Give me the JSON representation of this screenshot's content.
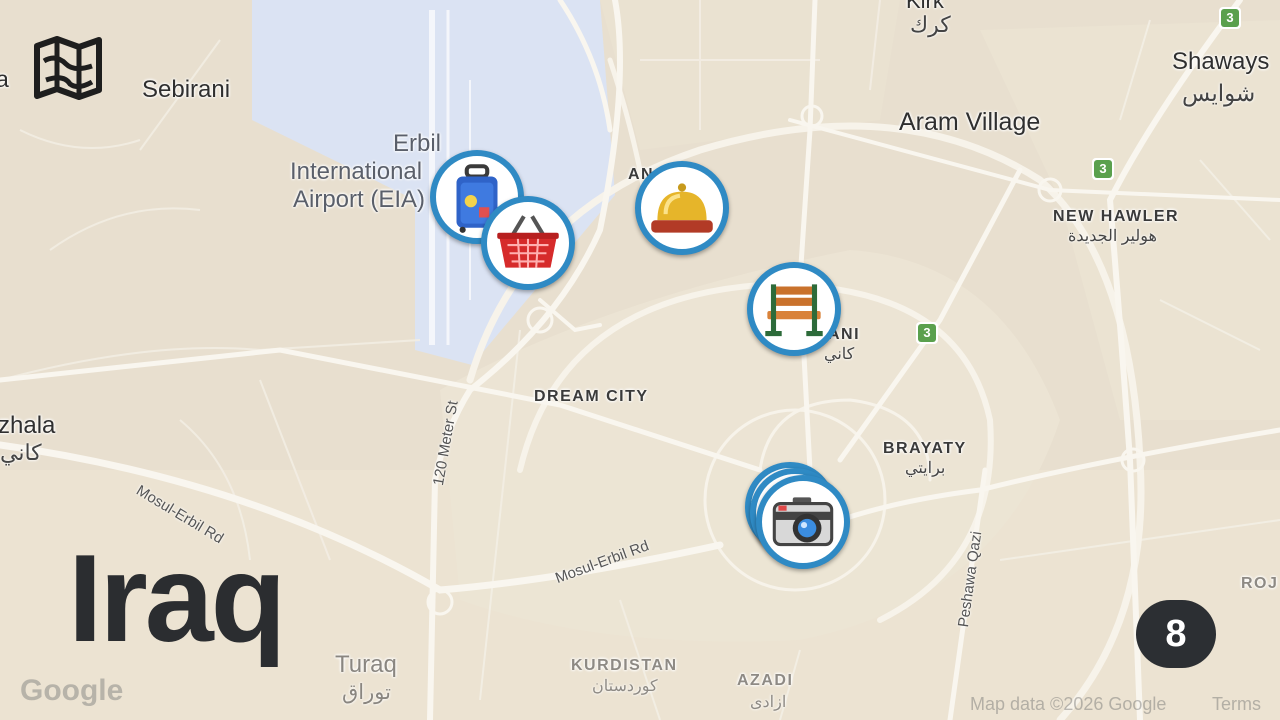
{
  "country_title": "Iraq",
  "marker_count": "8",
  "places": {
    "sebirani": "Sebirani",
    "airport_line1": "Erbil",
    "airport_line2": "International",
    "airport_line3": "Airport (EIA)",
    "aram_village": "Aram Village",
    "shaways": "Shaways",
    "shaways_ar": "شوايس",
    "kirk_ar": "كرك",
    "kirk": "Kirk",
    "new_hawler": "NEW HAWLER",
    "new_hawler_ar": "هولير الجديدة",
    "kani": "ANI",
    "kani_ar": "كاني",
    "dream_city": "DREAM CITY",
    "brayaty": "BRAYATY",
    "brayaty_ar": "برايتي",
    "zhala": "zhala",
    "zhala_ar": "كاني",
    "turaq": "Turaq",
    "turaq_ar": "توراق",
    "kurdistan": "KURDISTAN",
    "kurdistan_ar": "كوردستان",
    "azadi": "AZADI",
    "azadi_ar": "ازادی",
    "roj": "ROJ",
    "qa": "a",
    "ankawa": "AN"
  },
  "roads": {
    "meter120": "120 Meter St",
    "mosul_erbil_1": "Mosul-Erbil Rd",
    "mosul_erbil_2": "Mosul-Erbil Rd",
    "peshawa": "Peshawa Qazi"
  },
  "route_shields": [
    "3",
    "3",
    "3"
  ],
  "markers": [
    {
      "id": "luggage",
      "icon": "luggage-icon"
    },
    {
      "id": "shopping",
      "icon": "shopping-basket-icon"
    },
    {
      "id": "hotel",
      "icon": "service-bell-icon"
    },
    {
      "id": "park",
      "icon": "park-bench-icon"
    },
    {
      "id": "sightseeing",
      "icon": "camera-icon"
    }
  ],
  "attribution": {
    "google": "Google",
    "map_data": "Map data ©2026 Google",
    "terms": "Terms"
  },
  "colors": {
    "land": "#e8dfcf",
    "airport": "#dbe3f3",
    "road": "#f7f3ea",
    "marker_ring": "#2f8ac4",
    "badge_bg": "#2c2f33",
    "title": "#2b2d30"
  }
}
